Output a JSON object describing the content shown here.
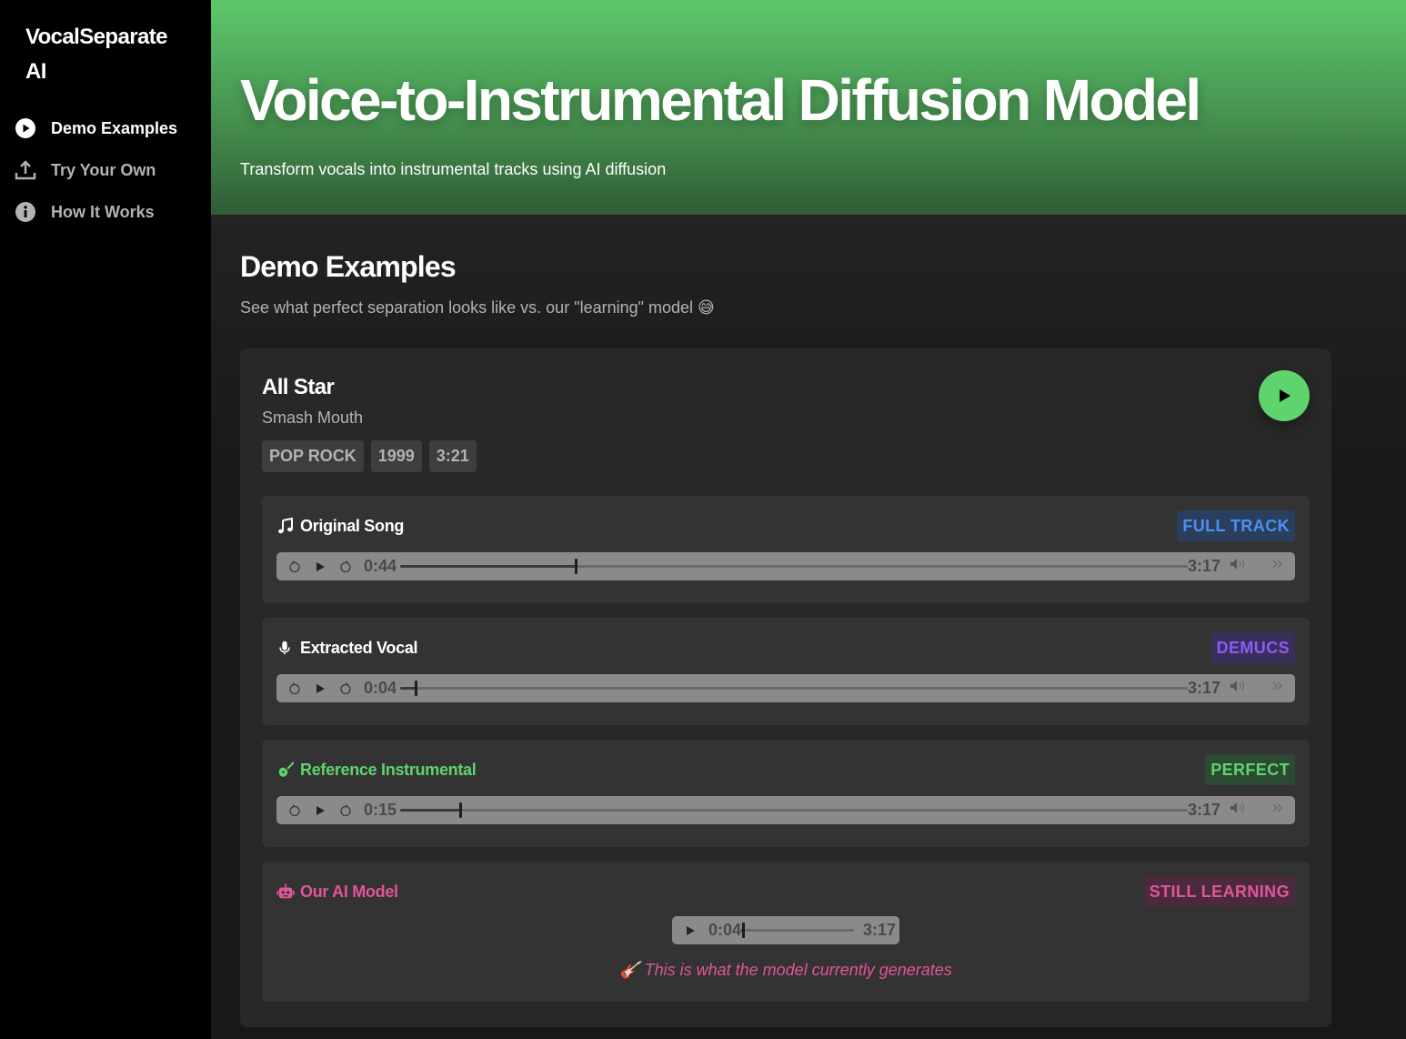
{
  "sidebar": {
    "brand": "VocalSeparate AI",
    "items": [
      {
        "label": "Demo Examples",
        "icon": "play-circle-icon",
        "active": true
      },
      {
        "label": "Try Your Own",
        "icon": "upload-icon",
        "active": false
      },
      {
        "label": "How It Works",
        "icon": "info-icon",
        "active": false
      }
    ]
  },
  "hero": {
    "title": "Voice-to-Instrumental Diffusion Model",
    "subtitle": "Transform vocals into instrumental tracks using AI diffusion"
  },
  "section": {
    "title": "Demo Examples",
    "subtitle": "See what perfect separation looks like vs. our \"learning\" model 😅"
  },
  "song": {
    "title": "All Star",
    "artist": "Smash Mouth",
    "tags": [
      "POP ROCK",
      "1999",
      "3:21"
    ]
  },
  "tracks": [
    {
      "label": "Original Song",
      "icon": "music-note-icon",
      "badge": "FULL TRACK",
      "current": "0:44",
      "duration": "3:17",
      "progress": 0.223,
      "label_color": "#ffffff",
      "badge_color": "#4c8ff0",
      "badge_bg": "#2a3f5e"
    },
    {
      "label": "Extracted Vocal",
      "icon": "microphone-icon",
      "badge": "DEMUCS",
      "current": "0:04",
      "duration": "3:17",
      "progress": 0.02,
      "label_color": "#ffffff",
      "badge_color": "#8b5cf6",
      "badge_bg": "#3a2f5a"
    },
    {
      "label": "Reference Instrumental",
      "icon": "guitar-icon",
      "badge": "PERFECT",
      "current": "0:15",
      "duration": "3:17",
      "progress": 0.076,
      "label_color": "#5fd36d",
      "badge_color": "#5fd36d",
      "badge_bg": "#2d4a33"
    }
  ],
  "ai_track": {
    "label": "Our AI Model",
    "icon": "robot-icon",
    "badge": "STILL LEARNING",
    "current": "0:04",
    "duration": "3:17",
    "progress": 0.02,
    "caption": "🎸 This is what the model currently generates",
    "color": "#e0559a",
    "badge_bg": "#4a2a3c"
  },
  "colors": {
    "accent": "#5fd36d",
    "sidebar_bg": "#000000",
    "card_bg": "#282828"
  }
}
